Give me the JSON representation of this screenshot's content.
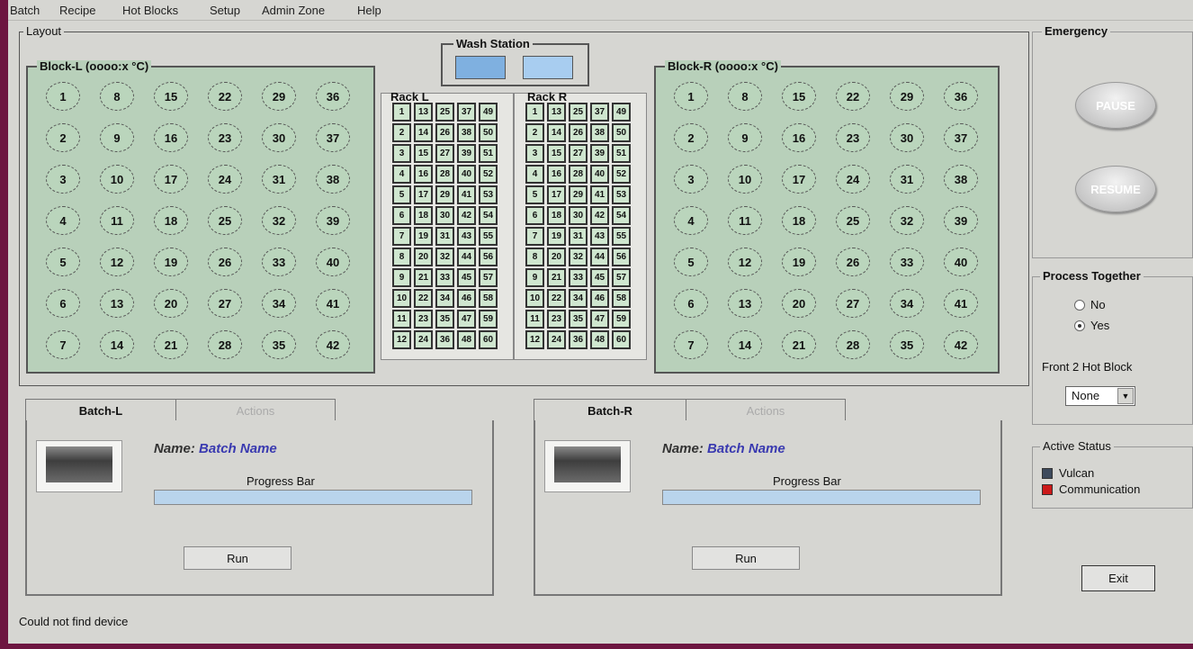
{
  "menu": [
    "Batch",
    "Recipe",
    "Hot Blocks",
    "Setup",
    "Admin Zone",
    "Help"
  ],
  "layout": {
    "title": "Layout",
    "wash_station_title": "Wash Station",
    "block_l": {
      "title": "Block-L (oooo:x °C)",
      "cells": [
        1,
        8,
        15,
        22,
        29,
        36,
        2,
        9,
        16,
        23,
        30,
        37,
        3,
        10,
        17,
        24,
        31,
        38,
        4,
        11,
        18,
        25,
        32,
        39,
        5,
        12,
        19,
        26,
        33,
        40,
        6,
        13,
        20,
        27,
        34,
        41,
        7,
        14,
        21,
        28,
        35,
        42
      ]
    },
    "block_r": {
      "title": "Block-R (oooo:x °C)",
      "cells": [
        1,
        8,
        15,
        22,
        29,
        36,
        2,
        9,
        16,
        23,
        30,
        37,
        3,
        10,
        17,
        24,
        31,
        38,
        4,
        11,
        18,
        25,
        32,
        39,
        5,
        12,
        19,
        26,
        33,
        40,
        6,
        13,
        20,
        27,
        34,
        41,
        7,
        14,
        21,
        28,
        35,
        42
      ]
    },
    "rack_l": {
      "title": "Rack L",
      "tubes": [
        1,
        13,
        25,
        37,
        49,
        2,
        14,
        26,
        38,
        50,
        3,
        15,
        27,
        39,
        51,
        4,
        16,
        28,
        40,
        52,
        5,
        17,
        29,
        41,
        53,
        6,
        18,
        30,
        42,
        54,
        7,
        19,
        31,
        43,
        55,
        8,
        20,
        32,
        44,
        56,
        9,
        21,
        33,
        45,
        57,
        10,
        22,
        34,
        46,
        58,
        11,
        23,
        35,
        47,
        59,
        12,
        24,
        36,
        48,
        60
      ]
    },
    "rack_r": {
      "title": "Rack R",
      "tubes": [
        1,
        13,
        25,
        37,
        49,
        2,
        14,
        26,
        38,
        50,
        3,
        15,
        27,
        39,
        51,
        4,
        16,
        28,
        40,
        52,
        5,
        17,
        29,
        41,
        53,
        6,
        18,
        30,
        42,
        54,
        7,
        19,
        31,
        43,
        55,
        8,
        20,
        32,
        44,
        56,
        9,
        21,
        33,
        45,
        57,
        10,
        22,
        34,
        46,
        58,
        11,
        23,
        35,
        47,
        59,
        12,
        24,
        36,
        48,
        60
      ]
    }
  },
  "emergency": {
    "title": "Emergency",
    "pause": "PAUSE",
    "resume": "RESUME"
  },
  "process_together": {
    "title": "Process Together",
    "options": [
      "No",
      "Yes"
    ],
    "selected": "Yes",
    "label": "Front 2 Hot Block",
    "select_value": "None"
  },
  "active_status": {
    "title": "Active Status",
    "items": [
      {
        "label": "Vulcan",
        "color": "#3d4a5c"
      },
      {
        "label": "Communication",
        "color": "#cc1a1a"
      }
    ]
  },
  "batch_l": {
    "tab_active": "Batch-L",
    "tab_inactive": "Actions",
    "name_label": "Name:",
    "name_value": "Batch Name",
    "progress_label": "Progress Bar",
    "run": "Run"
  },
  "batch_r": {
    "tab_active": "Batch-R",
    "tab_inactive": "Actions",
    "name_label": "Name:",
    "name_value": "Batch Name",
    "progress_label": "Progress Bar",
    "run": "Run"
  },
  "exit": "Exit",
  "status_message": "Could not find device"
}
